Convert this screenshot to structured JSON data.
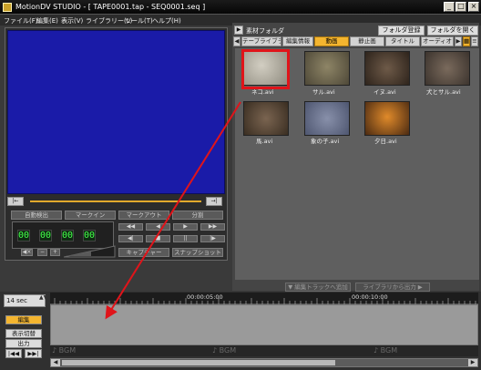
{
  "window": {
    "title": "MotionDV STUDIO - [ TAPE0001.tap - SEQ0001.seq ]",
    "min_glyph": "_",
    "max_glyph": "□",
    "close_glyph": "×"
  },
  "menu": [
    "ファイル(F)",
    "編集(E)",
    "表示(V)",
    "ライブラリー(L)",
    "ツール(T)",
    "ヘルプ(H)"
  ],
  "preview": {
    "seek_start_glyph": "|←",
    "seek_end_glyph": "→|",
    "controls": {
      "auto_detect": "自動検出",
      "mark_in": "マークイン",
      "mark_out": "マークアウト",
      "split": "分割",
      "capture": "キャプチャー",
      "snapshot": "スナップショット"
    },
    "counter": [
      "00",
      "00",
      "00",
      "00"
    ],
    "transport": [
      "◀◀",
      "◀",
      "▶",
      "▶▶",
      "◀|",
      "■",
      "||",
      "|▶"
    ],
    "volume": [
      "◀×",
      "−",
      "+"
    ]
  },
  "library": {
    "material_folder": "素材フォルダ",
    "register_folder": "フォルダ登録",
    "open_folder": "フォルダを開く",
    "tabs": [
      "テープライブラリ",
      "編集情報",
      "動画",
      "静止画",
      "タイトル",
      "オーディオ"
    ],
    "active_tab": "動画",
    "thumbnails": [
      {
        "label": "ネコ.avi",
        "color": "#b9b5a8"
      },
      {
        "label": "サル.avi",
        "color": "#6d6650"
      },
      {
        "label": "イヌ.avi",
        "color": "#4b3a2c"
      },
      {
        "label": "犬とサル.avi",
        "color": "#5d5048"
      },
      {
        "label": "馬.avi",
        "color": "#5a4a3a"
      },
      {
        "label": "象の子.avi",
        "color": "#6d7690"
      },
      {
        "label": "夕日.avi",
        "color": "#a16a2e"
      }
    ],
    "add_to_track": "▼ 編集トラックへ追加",
    "export_from_library": "ライブラリから出力 ▶"
  },
  "timeline": {
    "zoom": "14 sec",
    "edit_label": "編集",
    "display_switch": "表示切替",
    "output": "出力",
    "time_marks": [
      "00:00:05:00",
      "00:00:10:00"
    ],
    "bgm_label": "♪ BGM",
    "nav_left": "|◀◀",
    "nav_right": "▶▶|",
    "scroll_left": "◀",
    "scroll_right": "▶"
  },
  "colors": {
    "preview_blue": "#1a1ba8",
    "accent_orange": "#f4b52f",
    "selection_red": "#e0141a",
    "arrow_red": "#e0141a"
  }
}
